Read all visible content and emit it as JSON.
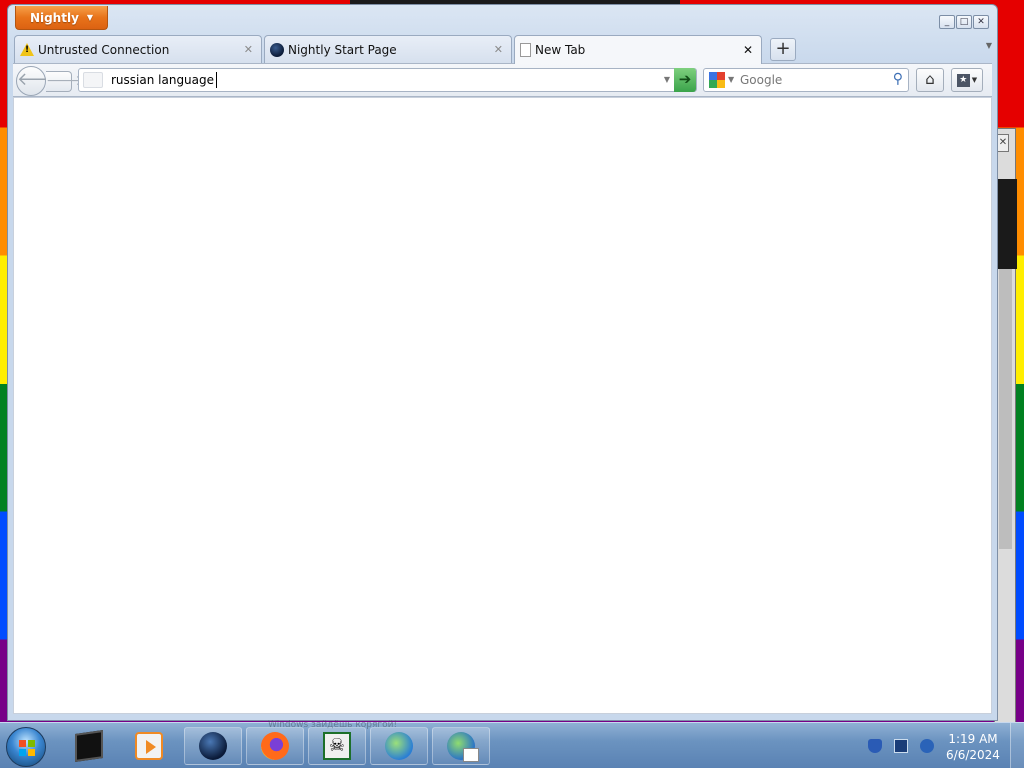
{
  "window": {
    "app_button_label": "Nightly"
  },
  "tabs": [
    {
      "label": "Untrusted Connection",
      "icon": "warning-icon",
      "active": false
    },
    {
      "label": "Nightly Start Page",
      "icon": "nightly-globe-icon",
      "active": false
    },
    {
      "label": "New Tab",
      "icon": "blank-page-icon",
      "active": true
    }
  ],
  "navbar": {
    "url_value": "russian language",
    "search_engine": "Google",
    "search_placeholder": "Google"
  },
  "taskbar": {
    "clock_time": "1:19 AM",
    "clock_date": "6/6/2024",
    "ghost_text": "Windows зайдёшь корягой!",
    "items": [
      {
        "name": "terminal-icon"
      },
      {
        "name": "media-player-icon"
      },
      {
        "name": "nightly-icon"
      },
      {
        "name": "firefox-icon"
      },
      {
        "name": "skull-app-icon"
      },
      {
        "name": "internet-explorer-icon"
      },
      {
        "name": "internet-tasks-icon"
      }
    ]
  },
  "colors": {
    "app_button": "#e8731a",
    "go_button": "#3aa34a",
    "taskbar": "#6b93c0"
  }
}
